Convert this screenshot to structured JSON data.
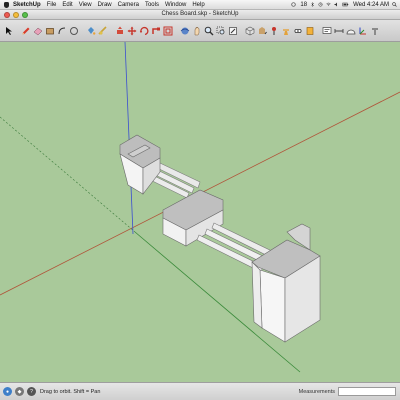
{
  "menubar": {
    "app_name": "SketchUp",
    "items": [
      "File",
      "Edit",
      "View",
      "Draw",
      "Camera",
      "Tools",
      "Window",
      "Help"
    ],
    "status_number": "18",
    "clock": "Wed 4:24 AM"
  },
  "window": {
    "title": "Chess Board.skp - SketchUp"
  },
  "toolbar": {
    "tools": [
      "select-icon",
      "pencil-icon",
      "eraser-icon",
      "paint-bucket-icon",
      "rectangle-icon",
      "circle-icon",
      "arc-icon",
      "polygon-icon",
      "freehand-icon",
      "move-icon",
      "push-pull-icon",
      "rotate-icon",
      "follow-me-icon",
      "scale-icon",
      "offset-icon",
      "orbit-icon",
      "pan-icon",
      "zoom-icon",
      "zoom-window-icon",
      "zoom-extents-icon",
      "tape-measure-icon",
      "protractor-icon",
      "axes-icon",
      "dimension-icon",
      "text-icon",
      "3d-text-icon",
      "section-plane-icon",
      "walk-icon",
      "look-around-icon",
      "position-camera-icon",
      "components-icon",
      "materials-icon"
    ]
  },
  "viewport": {
    "background": "#a9c99a",
    "axis_colors": {
      "red": "#b0553a",
      "green": "#3a8a3a",
      "blue": "#3b4fd0"
    }
  },
  "statusbar": {
    "hint": "Drag to orbit.  Shift = Pan",
    "measurements_label": "Measurements"
  }
}
